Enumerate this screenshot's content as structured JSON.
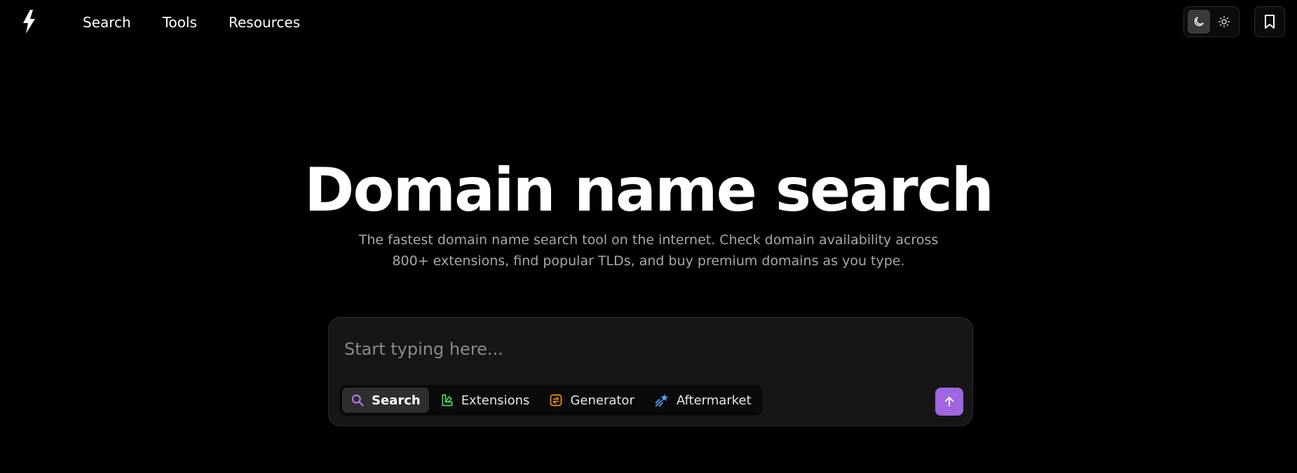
{
  "header": {
    "logo_icon": "bolt-icon",
    "nav": [
      {
        "label": "Search"
      },
      {
        "label": "Tools"
      },
      {
        "label": "Resources"
      }
    ],
    "theme": {
      "dark_icon": "moon-icon",
      "light_icon": "sun-icon",
      "selected": "dark"
    },
    "bookmark_icon": "bookmark-icon"
  },
  "hero": {
    "title": "Domain name search",
    "subtitle": "The fastest domain name search tool on the internet. Check domain availability across 800+ extensions, find popular TLDs, and buy premium domains as you type."
  },
  "search": {
    "placeholder": "Start typing here...",
    "value": "",
    "modes": [
      {
        "label": "Search",
        "icon": "magnifier-icon",
        "color": "#b57bf0",
        "active": true
      },
      {
        "label": "Extensions",
        "icon": "extensions-icon",
        "color": "#4cd964",
        "active": false
      },
      {
        "label": "Generator",
        "icon": "generator-icon",
        "color": "#f2911b",
        "active": false
      },
      {
        "label": "Aftermarket",
        "icon": "shooting-star-icon",
        "color": "#4aa3ff",
        "active": false
      }
    ],
    "submit_icon": "arrow-up-icon",
    "submit_color": "#a066e0"
  },
  "colors": {
    "background": "#000000",
    "card": "#161616",
    "accent": "#a066e0",
    "muted_text": "#a8a8a8"
  }
}
